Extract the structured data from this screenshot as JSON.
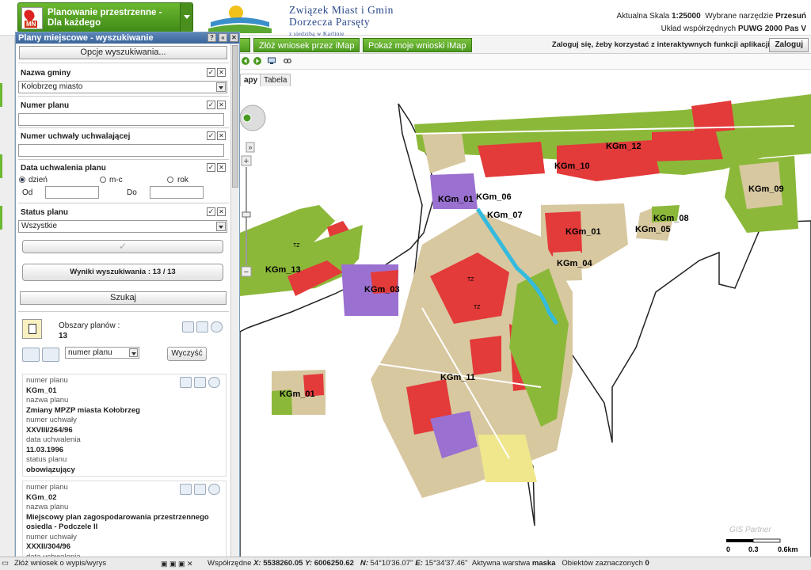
{
  "app_selector": {
    "title": "Planowanie przestrzenne - Dla każdego",
    "icon": "mpzp-pin-icon"
  },
  "org": {
    "line1": "Związek Miast i Gmin",
    "line2": "Dorzecza Parsęty",
    "line3": "z siedzibą w Karlinie"
  },
  "header": {
    "scale_label": "Aktualna Skala",
    "scale_value": "1:25000",
    "tool_label": "Wybrane narzędzie",
    "tool_value": "Przesuń",
    "crs_label": "Układ współrzędnych",
    "crs_value": "PUWG 2000 Pas V"
  },
  "toolbar": {
    "btn_zloz": "Złóż wniosek przez iMap",
    "btn_pokaz": "Pokaż moje wnioski iMap",
    "login_msg": "Zaloguj się, żeby korzystać z interaktywnych funkcji aplikacji",
    "login_btn": "Zaloguj"
  },
  "tabs": {
    "mapy": "apy",
    "tabela": "Tabela"
  },
  "panel": {
    "title": "Plany miejscowe - wyszukiwanie",
    "options_btn": "Opcje wyszukiwania...",
    "gmina_label": "Nazwa gminy",
    "gmina_value": "Kołobrzeg miasto",
    "numer_label": "Numer planu",
    "uchwala_label": "Numer uchwały uchwalającej",
    "data_label": "Data uchwalenia planu",
    "r_dzien": "dzień",
    "r_mc": "m-c",
    "r_rok": "rok",
    "od": "Od",
    "do": "Do",
    "status_label": "Status planu",
    "status_value": "Wszystkie",
    "wyniki": "Wyniki wyszukiwania : 13 / 13",
    "szukaj": "Szukaj",
    "obszary_label": "Obszary planów :",
    "obszary_count": "13",
    "sort_value": "numer planu",
    "wyczysc": "Wyczyść",
    "records": [
      {
        "l1": "numer planu",
        "v1": "KGm_01",
        "l2": "nazwa planu",
        "v2": "Zmiany MPZP miasta Kołobrzeg",
        "l3": "numer uchwały",
        "v3": "XXVIII/264/96",
        "l4": "data uchwalenia",
        "v4": "11.03.1996",
        "l5": "status planu",
        "v5": "obowiązujący"
      },
      {
        "l1": "numer planu",
        "v1": "KGm_02",
        "l2": "nazwa planu",
        "v2a": "Miejscowy plan zagospodarowania przestrzennego",
        "v2b": "osiedla - Podczele II",
        "l3": "numer uchwały",
        "v3": "XXXII/304/96",
        "l4": "data uchwalenia"
      }
    ]
  },
  "map": {
    "labels": [
      "KGm_12",
      "KGm_10",
      "KGm_09",
      "KGm_01",
      "KGm_06",
      "KGm_07",
      "KGm_08",
      "KGm_05",
      "KGm_01",
      "KGm_04",
      "KGm_13",
      "KGm_03",
      "KGm_11",
      "KGm_01"
    ],
    "tz": [
      "TZ",
      "TZ",
      "TZ"
    ],
    "partner": "GIS Partner",
    "scalebar": [
      "0",
      "0.3",
      "0.6km"
    ]
  },
  "status": {
    "win_label": "Złóż wniosek o wypis/wyrys",
    "coord_label": "Współrzędne",
    "x_label": "X:",
    "x": "5538260.05",
    "y_label": "Y:",
    "y": "6006250.62",
    "n_label": "N:",
    "n": "54°10'36.07''",
    "e_label": "E:",
    "e": "15°34'37.46''",
    "layer_label": "Aktywna warstwa",
    "layer": "maska",
    "sel_label": "Obiektów zaznaczonych",
    "sel": "0"
  }
}
